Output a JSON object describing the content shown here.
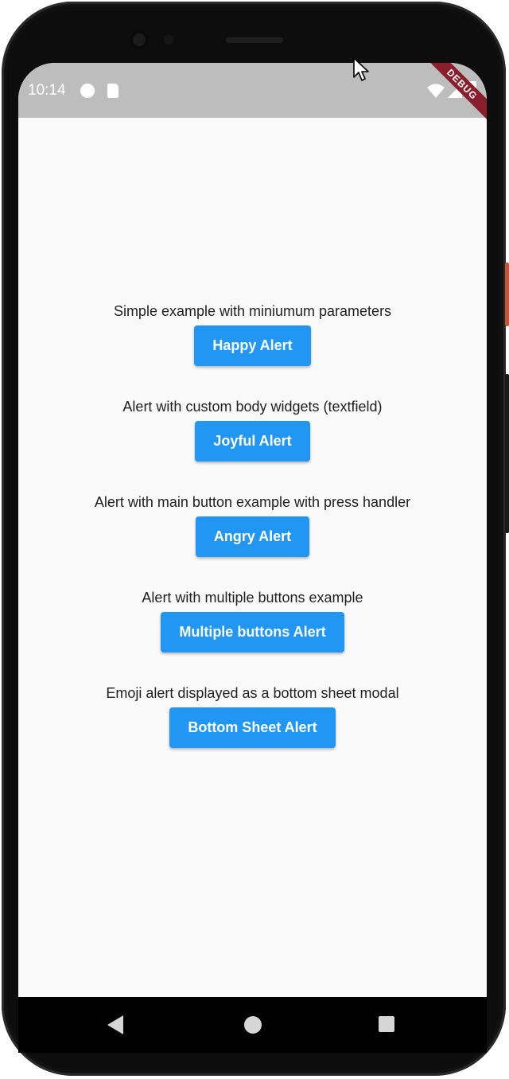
{
  "status_bar": {
    "time": "10:14",
    "debug_label": "DEBUG",
    "background": "#bdbdbd"
  },
  "icons": {
    "status_left": [
      "notification-circle-icon",
      "sd-card-icon"
    ],
    "status_right": [
      "wifi-icon",
      "cell-signal-icon",
      "battery-icon"
    ],
    "navigation": [
      "back-icon",
      "home-icon",
      "recents-icon"
    ]
  },
  "main": {
    "sections": [
      {
        "label": "Simple example with miniumum parameters",
        "button": "Happy Alert"
      },
      {
        "label": "Alert with custom body widgets (textfield)",
        "button": "Joyful Alert"
      },
      {
        "label": "Alert with main button example with press handler",
        "button": "Angry Alert"
      },
      {
        "label": "Alert with multiple buttons example",
        "button": "Multiple buttons Alert"
      },
      {
        "label": "Emoji alert displayed as a bottom sheet modal",
        "button": "Bottom Sheet Alert"
      }
    ]
  },
  "colors": {
    "button": "#2196f3",
    "button_text": "#ffffff",
    "page_background": "#fafafa",
    "debug_banner": "#8b1e2c"
  }
}
